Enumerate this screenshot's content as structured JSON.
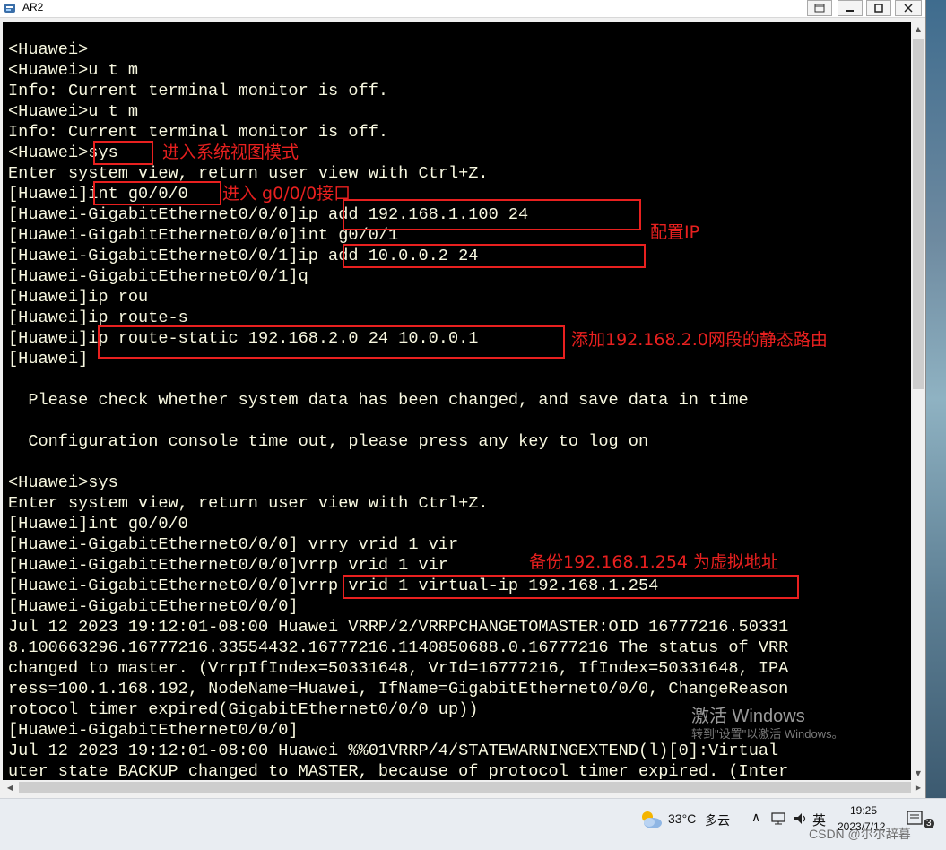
{
  "window": {
    "title": "AR2",
    "controls": [
      "restore",
      "minimize",
      "maximize",
      "close"
    ]
  },
  "terminal": {
    "lines": [
      "<Huawei>",
      "<Huawei>u t m",
      "Info: Current terminal monitor is off.",
      "<Huawei>u t m",
      "Info: Current terminal monitor is off.",
      "<Huawei>sys",
      "Enter system view, return user view with Ctrl+Z.",
      "[Huawei]int g0/0/0",
      "[Huawei-GigabitEthernet0/0/0]ip add 192.168.1.100 24",
      "[Huawei-GigabitEthernet0/0/0]int g0/0/1",
      "[Huawei-GigabitEthernet0/0/1]ip add 10.0.0.2 24",
      "[Huawei-GigabitEthernet0/0/1]q",
      "[Huawei]ip rou",
      "[Huawei]ip route-s",
      "[Huawei]ip route-static 192.168.2.0 24 10.0.0.1",
      "[Huawei]",
      "",
      "  Please check whether system data has been changed, and save data in time",
      "",
      "  Configuration console time out, please press any key to log on",
      "",
      "<Huawei>sys",
      "Enter system view, return user view with Ctrl+Z.",
      "[Huawei]int g0/0/0",
      "[Huawei-GigabitEthernet0/0/0] vrry vrid 1 vir",
      "[Huawei-GigabitEthernet0/0/0]vrrp vrid 1 vir",
      "[Huawei-GigabitEthernet0/0/0]vrrp vrid 1 virtual-ip 192.168.1.254",
      "[Huawei-GigabitEthernet0/0/0]",
      "Jul 12 2023 19:12:01-08:00 Huawei VRRP/2/VRRPCHANGETOMASTER:OID 16777216.50331",
      "8.100663296.16777216.33554432.16777216.1140850688.0.16777216 The status of VRR",
      "changed to master. (VrrpIfIndex=50331648, VrId=16777216, IfIndex=50331648, IPA",
      "ress=100.1.168.192, NodeName=Huawei, IfName=GigabitEthernet0/0/0, ChangeReason",
      "rotocol timer expired(GigabitEthernet0/0/0 up))",
      "[Huawei-GigabitEthernet0/0/0]",
      "Jul 12 2023 19:12:01-08:00 Huawei %%01VRRP/4/STATEWARNINGEXTEND(l)[0]:Virtual",
      "uter state BACKUP changed to MASTER, because of protocol timer expired. (Inter"
    ]
  },
  "annotations": {
    "sys_label": "进入系统视图模式",
    "int_label": "进入 g0/0/0接口",
    "ip_label": "配置IP",
    "route_label": "添加192.168.2.0网段的静态路由",
    "vrrp_label": "备份192.168.1.254 为虚拟地址"
  },
  "watermark": {
    "line1": "激活 Windows",
    "line2": "转到\"设置\"以激活 Windows。"
  },
  "taskbar": {
    "weather_temp": "33°C",
    "weather_desc": "多云",
    "ime": "英",
    "time": "19:25",
    "date": "2023/7/12",
    "csdn": "CSDN @尔尔辞暮",
    "notification_count": "3"
  },
  "colors": {
    "terminal_bg": "#000000",
    "terminal_text": "#f8f8e0",
    "annotation_red": "#e8201f"
  }
}
